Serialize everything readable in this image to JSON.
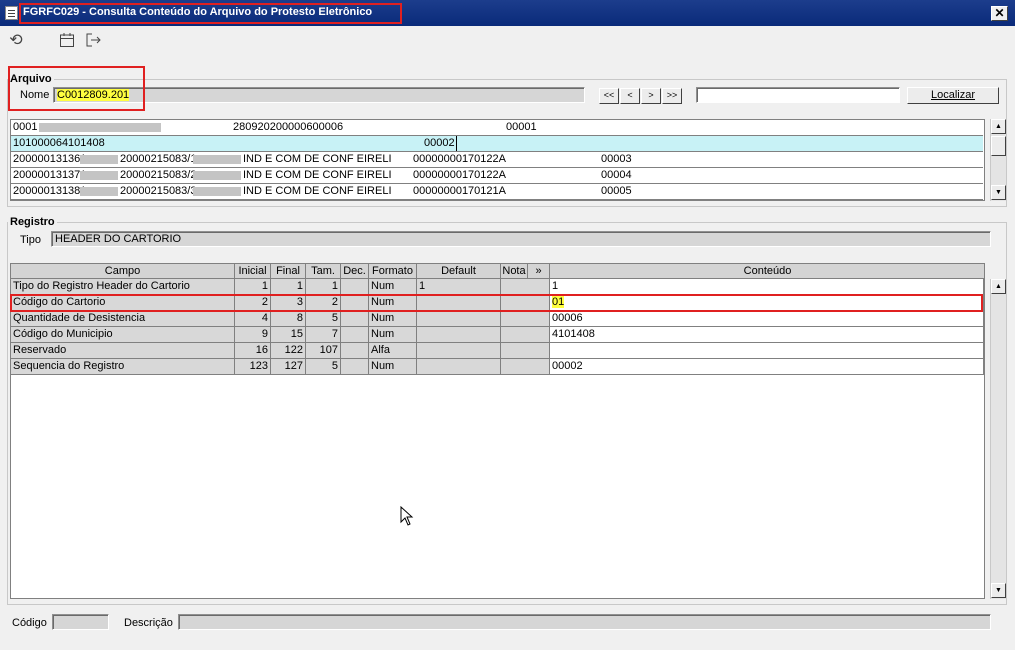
{
  "window": {
    "title": "FGRFC029 - Consulta Conteúdo do Arquivo do Protesto Eletrônico",
    "close_label": "✕"
  },
  "toolbar": {
    "refresh_icon": "refresh-icon",
    "calendar_icon": "calendar-icon",
    "exit_icon": "exit-icon"
  },
  "arquivo": {
    "legend": "Arquivo",
    "nome_label": "Nome",
    "nome_value": "C0012809.201",
    "nav": [
      "<<",
      "<",
      ">",
      ">>"
    ],
    "search_value": "",
    "localizar_label": "Localizar",
    "rows": [
      {
        "c1": "0001",
        "c2": "280920200000600006",
        "c3": "00001",
        "blur1": true
      },
      {
        "c1": "101000064101408",
        "c2": "00002",
        "selected": true
      },
      {
        "c1": "200000131361",
        "c1b": "20000215083/1",
        "c2": "IND E COM DE CONF EIRELI",
        "c3": "00000000170122A",
        "c4": "00003"
      },
      {
        "c1": "200000131371",
        "c1b": "20000215083/2",
        "c2": "IND E COM DE CONF EIRELI",
        "c3": "00000000170122A",
        "c4": "00004"
      },
      {
        "c1": "200000131381",
        "c1b": "20000215083/3",
        "c2": "IND E COM DE CONF EIRELI",
        "c3": "00000000170121A",
        "c4": "00005"
      }
    ]
  },
  "registro": {
    "legend": "Registro",
    "tipo_label": "Tipo",
    "tipo_value": "HEADER DO CARTORIO",
    "columns": [
      "Campo",
      "Inicial",
      "Final",
      "Tam.",
      "Dec.",
      "Formato",
      "Default",
      "Nota",
      "»",
      "Conteúdo"
    ],
    "rows": [
      {
        "campo": "Tipo do Registro Header do Cartorio",
        "inicial": "1",
        "final": "1",
        "tam": "1",
        "dec": "",
        "formato": "Num",
        "default": "1",
        "nota": "",
        "conteudo": "1"
      },
      {
        "campo": "Código do Cartorio",
        "inicial": "2",
        "final": "3",
        "tam": "2",
        "dec": "",
        "formato": "Num",
        "default": "",
        "nota": "",
        "conteudo": "01"
      },
      {
        "campo": "Quantidade de Desistencia",
        "inicial": "4",
        "final": "8",
        "tam": "5",
        "dec": "",
        "formato": "Num",
        "default": "",
        "nota": "",
        "conteudo": "00006"
      },
      {
        "campo": "Código do Municipio",
        "inicial": "9",
        "final": "15",
        "tam": "7",
        "dec": "",
        "formato": "Num",
        "default": "",
        "nota": "",
        "conteudo": "4101408"
      },
      {
        "campo": "Reservado",
        "inicial": "16",
        "final": "122",
        "tam": "107",
        "dec": "",
        "formato": "Alfa",
        "default": "",
        "nota": "",
        "conteudo": ""
      },
      {
        "campo": "Sequencia do Registro",
        "inicial": "123",
        "final": "127",
        "tam": "5",
        "dec": "",
        "formato": "Num",
        "default": "",
        "nota": "",
        "conteudo": "00002"
      }
    ]
  },
  "footer": {
    "codigo_label": "Código",
    "codigo_value": "",
    "descricao_label": "Descrição",
    "descricao_value": ""
  },
  "colors": {
    "title_bar": "#0a2a7a",
    "highlight": "#ffff40",
    "annotation_red": "#e02020",
    "selected_row": "#c8f2f6"
  }
}
